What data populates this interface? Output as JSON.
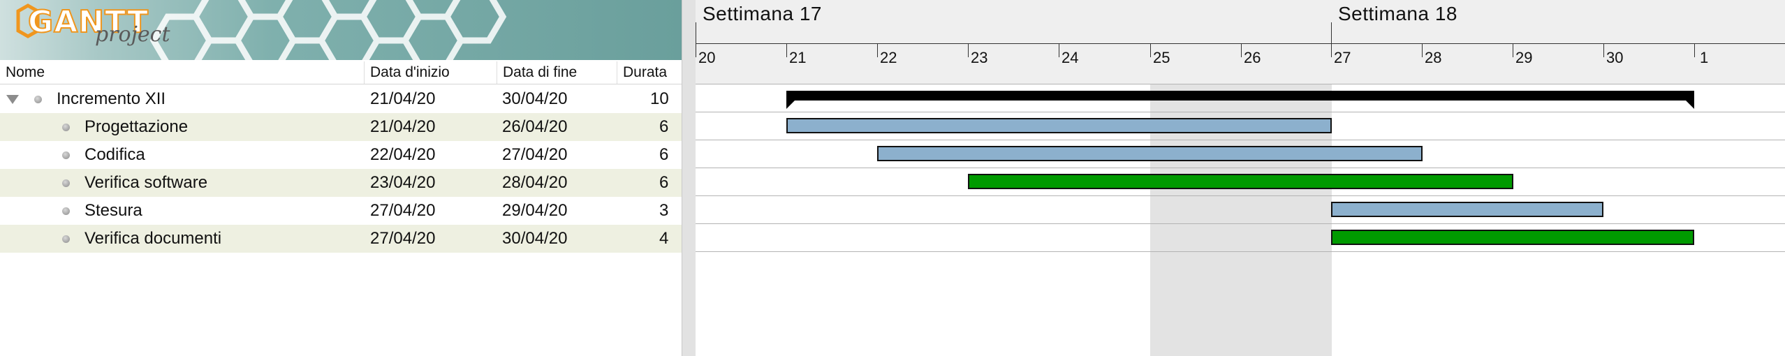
{
  "app": {
    "logo_main": "GANTT",
    "logo_sub": "project"
  },
  "columns": {
    "name": "Nome",
    "start": "Data d'inizio",
    "end": "Data di fine",
    "duration": "Durata"
  },
  "tasks": [
    {
      "name": "Incremento XII",
      "start": "21/04/20",
      "end": "30/04/20",
      "duration": "10",
      "type": "summary"
    },
    {
      "name": "Progettazione",
      "start": "21/04/20",
      "end": "26/04/20",
      "duration": "6",
      "color": "#8cb0cd"
    },
    {
      "name": "Codifica",
      "start": "22/04/20",
      "end": "27/04/20",
      "duration": "6",
      "color": "#8cb0cd"
    },
    {
      "name": "Verifica software",
      "start": "23/04/20",
      "end": "28/04/20",
      "duration": "6",
      "color": "#009a00"
    },
    {
      "name": "Stesura",
      "start": "27/04/20",
      "end": "29/04/20",
      "duration": "3",
      "color": "#8cb0cd"
    },
    {
      "name": "Verifica documenti",
      "start": "27/04/20",
      "end": "30/04/20",
      "duration": "4",
      "color": "#009a00"
    }
  ],
  "timeline": {
    "weeks": [
      "Settimana  17",
      "Settimana  18"
    ],
    "days": [
      "20",
      "21",
      "22",
      "23",
      "24",
      "25",
      "26",
      "27",
      "28",
      "29",
      "30",
      "1"
    ]
  },
  "colors": {
    "header_bg": "#efefef",
    "weekend_bg": "#e3e3e3",
    "alt_row": "#eef0e1",
    "logo_orange": "#f0961e"
  }
}
